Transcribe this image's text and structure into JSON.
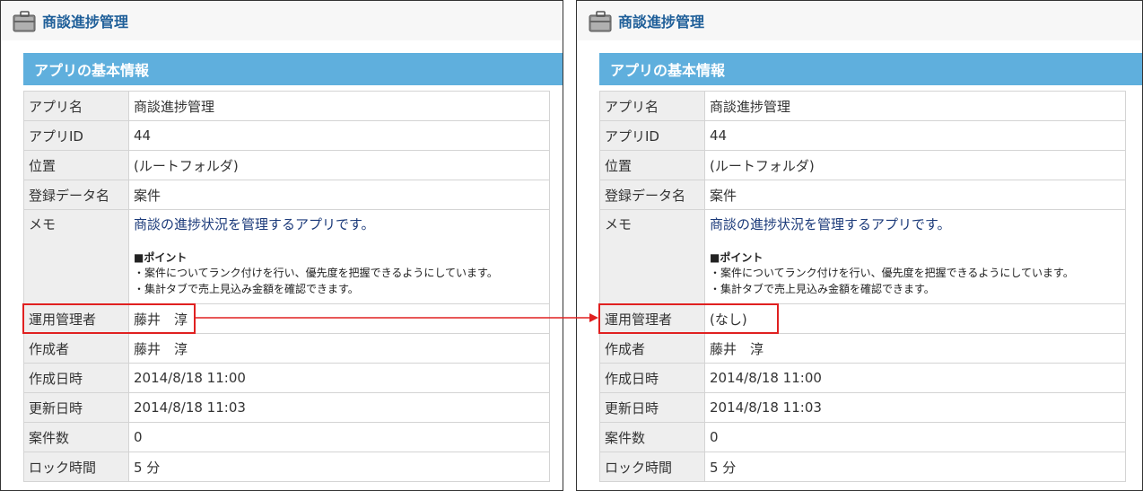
{
  "left": {
    "app_title": "商談進捗管理",
    "section_title": "アプリの基本情報",
    "rows": [
      {
        "label": "アプリ名",
        "value": "商談進捗管理"
      },
      {
        "label": "アプリID",
        "value": "44"
      },
      {
        "label": "位置",
        "value": "(ルートフォルダ)"
      },
      {
        "label": "登録データ名",
        "value": "案件"
      },
      {
        "label": "メモ",
        "memo": {
          "main": "商談の進捗状況を管理するアプリです。",
          "point": "■ポイント",
          "line1": "・案件についてランク付けを行い、優先度を把握できるようにしています。",
          "line2": "・集計タブで売上見込み金額を確認できます。"
        }
      },
      {
        "label": "運用管理者",
        "value": "藤井　淳"
      },
      {
        "label": "作成者",
        "value": "藤井　淳"
      },
      {
        "label": "作成日時",
        "value": "2014/8/18 11:00"
      },
      {
        "label": "更新日時",
        "value": "2014/8/18 11:03"
      },
      {
        "label": "案件数",
        "value": "0"
      },
      {
        "label": "ロック時間",
        "value": "5 分"
      }
    ]
  },
  "right": {
    "app_title": "商談進捗管理",
    "section_title": "アプリの基本情報",
    "rows": [
      {
        "label": "アプリ名",
        "value": "商談進捗管理"
      },
      {
        "label": "アプリID",
        "value": "44"
      },
      {
        "label": "位置",
        "value": "(ルートフォルダ)"
      },
      {
        "label": "登録データ名",
        "value": "案件"
      },
      {
        "label": "メモ",
        "memo": {
          "main": "商談の進捗状況を管理するアプリです。",
          "point": "■ポイント",
          "line1": "・案件についてランク付けを行い、優先度を把握できるようにしています。",
          "line2": "・集計タブで売上見込み金額を確認できます。"
        }
      },
      {
        "label": "運用管理者",
        "value": "(なし)"
      },
      {
        "label": "作成者",
        "value": "藤井　淳"
      },
      {
        "label": "作成日時",
        "value": "2014/8/18 11:00"
      },
      {
        "label": "更新日時",
        "value": "2014/8/18 11:03"
      },
      {
        "label": "案件数",
        "value": "0"
      },
      {
        "label": "ロック時間",
        "value": "5 分"
      }
    ]
  },
  "colors": {
    "section_bar": "#5fafdd",
    "title": "#1f5f99",
    "highlight": "#e02020",
    "memo_text": "#1b3a7a"
  },
  "icons": [
    "briefcase-icon"
  ]
}
